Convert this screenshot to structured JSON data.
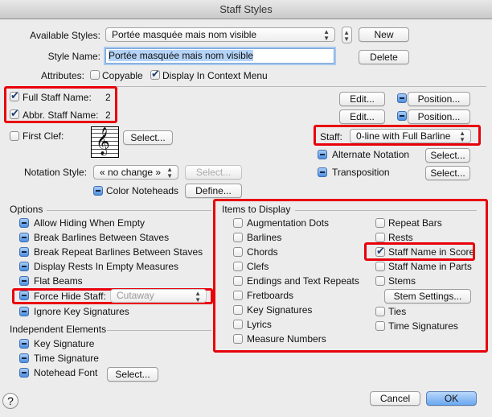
{
  "window": {
    "title": "Staff Styles"
  },
  "top": {
    "available_label": "Available Styles:",
    "available_value": "Portée masquée mais nom visible",
    "new_label": "New",
    "style_name_label": "Style Name:",
    "style_name_value": "Portée masquée mais nom visible",
    "delete_label": "Delete",
    "attributes_label": "Attributes:",
    "copyable_label": "Copyable",
    "copyable_checked": false,
    "context_label": "Display In Context Menu",
    "context_checked": true
  },
  "names": {
    "full_label": "Full Staff Name:",
    "full_value": "2",
    "abbr_label": "Abbr. Staff Name:",
    "abbr_value": "2",
    "edit_label": "Edit...",
    "position_label": "Position..."
  },
  "clef": {
    "label": "First Clef:",
    "select_label": "Select..."
  },
  "staff": {
    "label": "Staff:",
    "value": "0-line with Full Barline",
    "alt_label": "Alternate Notation",
    "transposition_label": "Transposition",
    "select_label": "Select..."
  },
  "notation": {
    "label": "Notation Style:",
    "value": "« no change »",
    "select_label": "Select...",
    "color_label": "Color Noteheads",
    "define_label": "Define..."
  },
  "options": {
    "title": "Options",
    "items": [
      "Allow Hiding When Empty",
      "Break Barlines Between Staves",
      "Break Repeat Barlines Between Staves",
      "Display Rests In Empty Measures",
      "Flat Beams"
    ],
    "force_label": "Force Hide Staff:",
    "force_value": "Cutaway",
    "ignore_label": "Ignore Key Signatures"
  },
  "independent": {
    "title": "Independent Elements",
    "items": [
      "Key Signature",
      "Time Signature",
      "Notehead Font"
    ],
    "select_label": "Select..."
  },
  "display": {
    "title": "Items to Display",
    "left": [
      "Augmentation Dots",
      "Barlines",
      "Chords",
      "Clefs",
      "Endings and Text Repeats",
      "Fretboards",
      "Key Signatures",
      "Lyrics",
      "Measure Numbers"
    ],
    "right": [
      {
        "label": "Repeat Bars",
        "checked": false
      },
      {
        "label": "Rests",
        "checked": false
      },
      {
        "label": "Staff Name in Score",
        "checked": true
      },
      {
        "label": "Staff Name in Parts",
        "checked": false
      },
      {
        "label": "Stems",
        "checked": false
      },
      {
        "label": "Ties",
        "checked": false
      },
      {
        "label": "Time Signatures",
        "checked": false
      }
    ],
    "stem_settings_label": "Stem Settings..."
  },
  "footer": {
    "help_label": "?",
    "cancel_label": "Cancel",
    "ok_label": "OK"
  },
  "colors": {
    "highlight": "#e8000b",
    "default_button": "#6aa7ef"
  }
}
